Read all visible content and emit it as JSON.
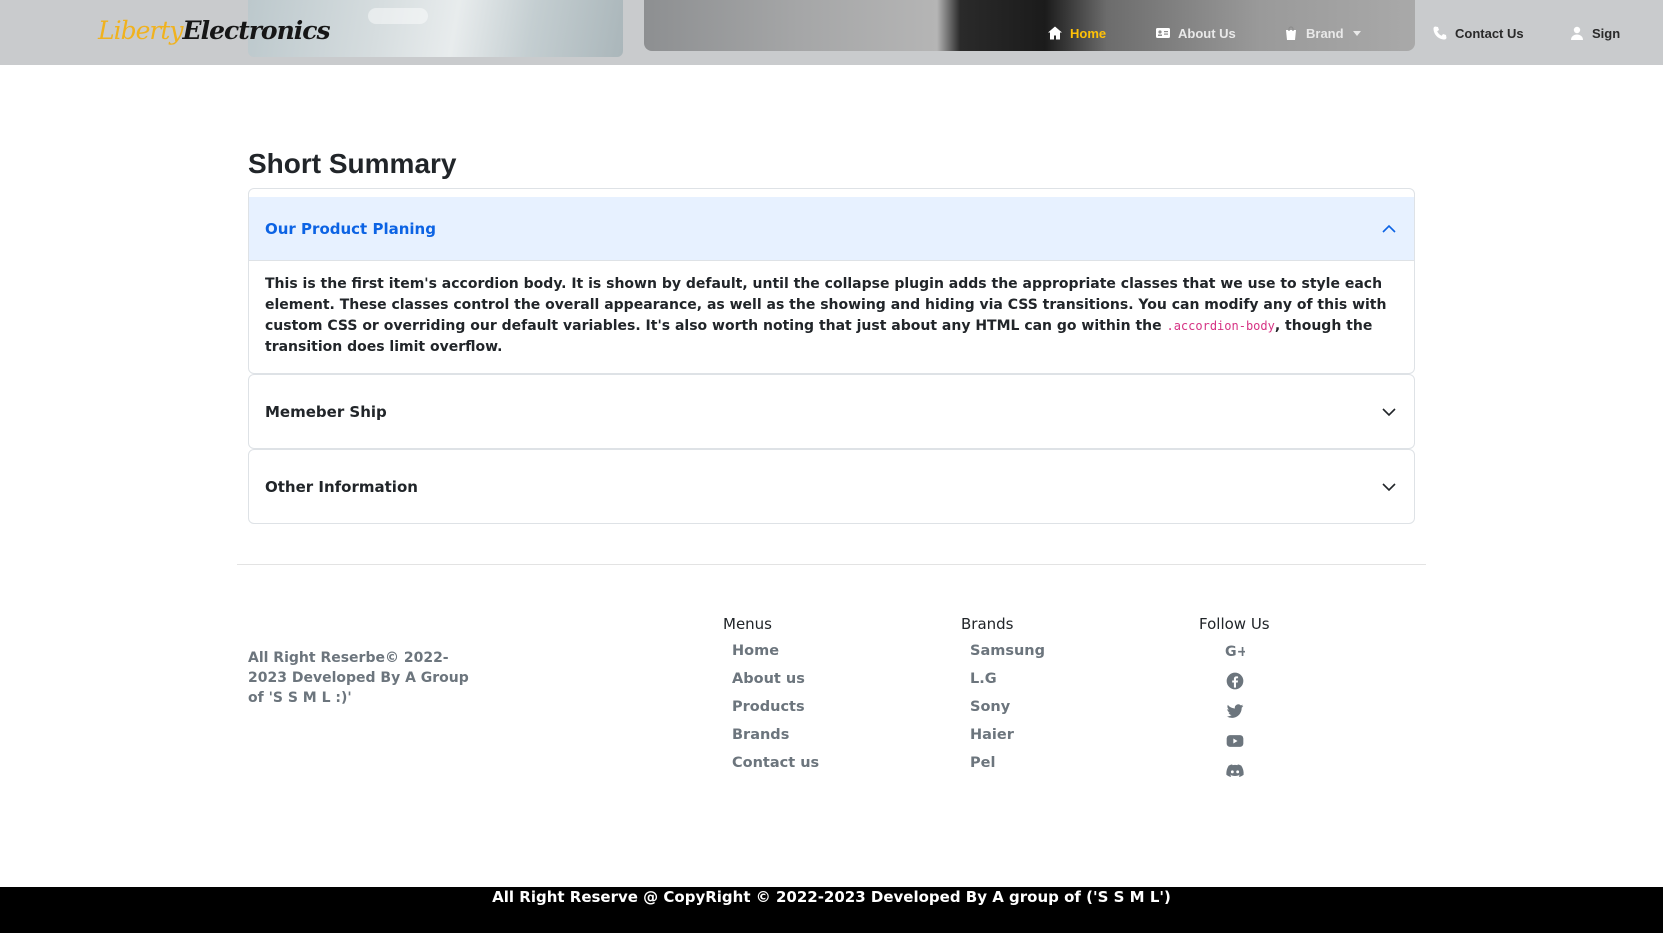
{
  "header": {
    "brand_part1": "Liberty",
    "brand_part2": "Electronics",
    "nav": {
      "home": "Home",
      "about": "About Us",
      "brand": "Brand",
      "contact": "Contact Us",
      "signin": "Sign"
    }
  },
  "main": {
    "title": "Short Summary",
    "accordion": [
      {
        "title": "Our Product Planing",
        "expanded": true,
        "body_text": "This is the first item's accordion body. It is shown by default, until the collapse plugin adds the appropriate classes that we use to style each element. These classes control the overall appearance, as well as the showing and hiding via CSS transitions. You can modify any of this with custom CSS or overriding our default variables. It's also worth noting that just about any HTML can go within the ",
        "body_code": ".accordion-body",
        "body_tail": ", though the transition does limit overflow."
      },
      {
        "title": "Memeber Ship",
        "expanded": false
      },
      {
        "title": "Other Information",
        "expanded": false
      }
    ]
  },
  "footer": {
    "copyright_left": "All Right Reserbe© 2022-2023 Developed By A Group of 'S S M L :)'",
    "menus": {
      "heading": "Menus",
      "items": [
        "Home",
        "About us",
        "Products",
        "Brands",
        "Contact us"
      ]
    },
    "brands": {
      "heading": "Brands",
      "items": [
        "Samsung",
        "L.G",
        "Sony",
        "Haier",
        "Pel"
      ]
    },
    "follow": {
      "heading": "Follow Us",
      "icons": [
        "google-plus-icon",
        "facebook-icon",
        "twitter-icon",
        "youtube-icon",
        "discord-icon"
      ]
    },
    "bottom_bar": "All Right Reserve @ CopyRight © 2022-2023 Developed By A group of ('S S M L')"
  },
  "colors": {
    "accent_yellow": "#ffc107",
    "accordion_active_bg": "#e7f1ff",
    "accordion_active_text": "#0c63e4",
    "footer_muted": "#6c757d",
    "bottom_bar_bg": "#000000"
  }
}
